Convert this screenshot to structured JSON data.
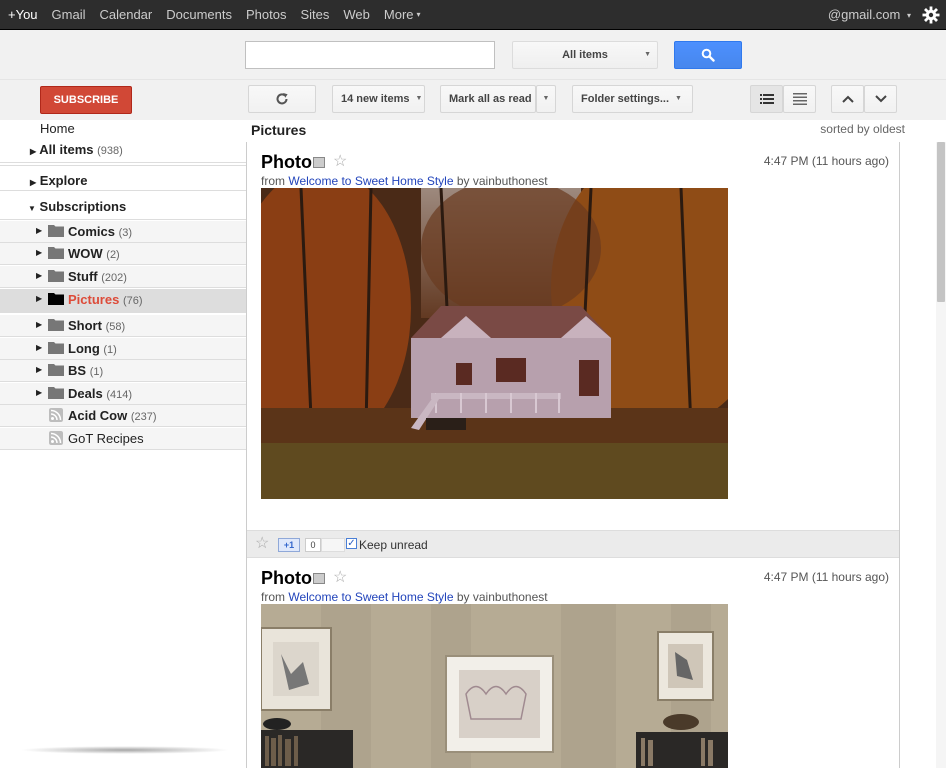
{
  "topbar": {
    "links": [
      "+You",
      "Gmail",
      "Calendar",
      "Documents",
      "Photos",
      "Sites",
      "Web",
      "More"
    ],
    "more_caret": "▾",
    "account": "@gmail.com",
    "account_caret": "▾"
  },
  "search": {
    "value": "",
    "scope": "All items",
    "button_icon": "search-icon"
  },
  "toolbar": {
    "subscribe": "SUBSCRIBE",
    "new_items": "14 new items",
    "mark_all_read": "Mark all as read",
    "folder_settings": "Folder settings...",
    "dropdown_caret": "▾"
  },
  "sidebar": {
    "home": "Home",
    "all_items": {
      "label": "All items",
      "count": "(938)"
    },
    "explore": "Explore",
    "subscriptions": "Subscriptions",
    "folders": [
      {
        "label": "Comics",
        "count": "(3)",
        "type": "folder"
      },
      {
        "label": "WOW",
        "count": "(2)",
        "type": "folder"
      },
      {
        "label": "Stuff",
        "count": "(202)",
        "type": "folder"
      },
      {
        "label": "Pictures",
        "count": "(76)",
        "type": "folder",
        "selected": true
      },
      {
        "label": "Short",
        "count": "(58)",
        "type": "folder"
      },
      {
        "label": "Long",
        "count": "(1)",
        "type": "folder"
      },
      {
        "label": "BS",
        "count": "(1)",
        "type": "folder"
      },
      {
        "label": "Deals",
        "count": "(414)",
        "type": "folder"
      },
      {
        "label": "Acid Cow",
        "count": "(237)",
        "type": "feed"
      },
      {
        "label": "GoT Recipes",
        "count": "",
        "type": "feed"
      }
    ]
  },
  "stream": {
    "title": "Pictures",
    "sort": "sorted by oldest",
    "entries": [
      {
        "title": "Photo",
        "time": "4:47 PM (11 hours ago)",
        "from_prefix": "from",
        "source": "Welcome to Sweet Home Style",
        "by": "by vainbuthonest",
        "image": "autumn forest cottage photo"
      },
      {
        "title": "Photo",
        "time": "4:47 PM (11 hours ago)",
        "from_prefix": "from",
        "source": "Welcome to Sweet Home Style",
        "by": "by vainbuthonest",
        "image": "interior wall with framed artworks photo"
      }
    ],
    "actions": {
      "plus_one": "+1",
      "plus_count": "0",
      "keep_unread": "Keep unread",
      "keep_unread_checked": true
    }
  },
  "colors": {
    "topbar": "#2d2d2d",
    "subscribe": "#d14836",
    "search_button": "#4d90fe",
    "selected_folder_text": "#dd4b39",
    "link": "#2244bb"
  }
}
